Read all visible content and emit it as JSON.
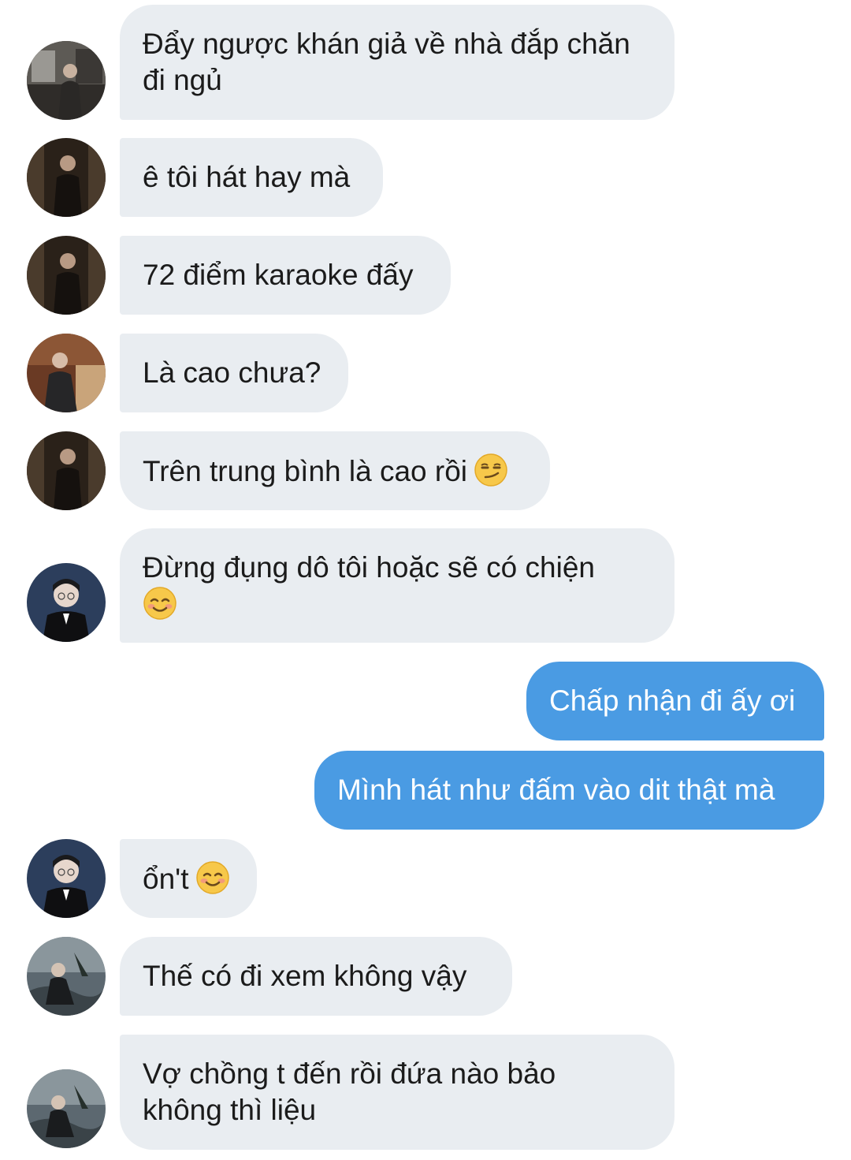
{
  "messages": [
    {
      "sender": "other",
      "avatar": "avatar-suit-man",
      "lines": [
        "Đẩy ngược khán giả về nhà đắp chăn",
        "đi ngủ"
      ]
    },
    {
      "sender": "other",
      "avatar": "avatar-dark-suit-man",
      "lines": [
        "ê tôi hát hay mà"
      ]
    },
    {
      "sender": "other",
      "avatar": "avatar-dark-suit-man",
      "lines": [
        "72 điểm karaoke đấy"
      ]
    },
    {
      "sender": "other",
      "avatar": "avatar-seated-man",
      "lines": [
        "Là cao chưa?"
      ]
    },
    {
      "sender": "other",
      "avatar": "avatar-dark-suit-man",
      "lines": [
        "Trên trung bình là cao rồi"
      ],
      "emoji": "smirking-face-emoji"
    },
    {
      "sender": "other",
      "avatar": "avatar-glasses-man",
      "lines": [
        "Đừng đụng dô tôi hoặc sẽ có chiện",
        ""
      ],
      "emoji": "smiling-face-emoji"
    },
    {
      "sender": "me",
      "lines": [
        "Chấp nhận đi ấy ơi"
      ]
    },
    {
      "sender": "me",
      "lines": [
        "Mình hát như đấm vào dit thật mà"
      ]
    },
    {
      "sender": "other",
      "avatar": "avatar-glasses-man",
      "lines": [
        "ổn't"
      ],
      "emoji": "smiling-face-emoji"
    },
    {
      "sender": "other",
      "avatar": "avatar-outdoor-man",
      "lines": [
        "Thế có đi xem không vậy"
      ]
    },
    {
      "sender": "other",
      "avatar": "avatar-outdoor-man",
      "lines": [
        "Vợ chồng t đến rồi đứa nào bảo",
        "không thì liệu"
      ]
    }
  ],
  "colors": {
    "incoming_bubble": "#e9edf1",
    "outgoing_bubble": "#4a9be3",
    "incoming_text": "#1b1b1b",
    "outgoing_text": "#ffffff"
  }
}
